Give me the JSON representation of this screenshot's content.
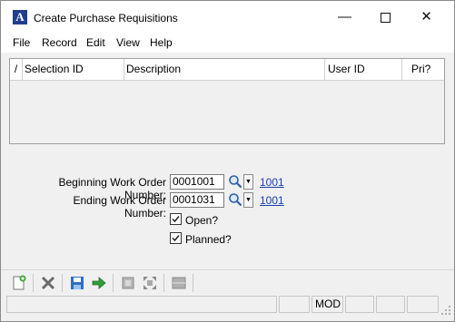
{
  "window": {
    "title": "Create Purchase Requisitions",
    "minimize": "—",
    "close": "✕"
  },
  "menu": [
    "File",
    "Record",
    "Edit",
    "View",
    "Help"
  ],
  "grid": {
    "sort_indicator": "/",
    "columns": [
      "Selection ID",
      "Description",
      "User ID",
      "Pri?"
    ],
    "rows": []
  },
  "form": {
    "begin_label": "Beginning Work Order Number:",
    "begin_value": "0001001",
    "begin_link": "1001",
    "end_label": "Ending Work Order Number:",
    "end_value": "0001031",
    "end_link": "1001",
    "open_label": "Open?",
    "open_checked": true,
    "planned_label": "Planned?",
    "planned_checked": true
  },
  "toolbar": {
    "icons": [
      "new-record-icon",
      "delete-icon",
      "save-icon",
      "proceed-icon",
      "detail-icon",
      "expand-icon",
      "list-icon"
    ]
  },
  "status": {
    "mode": "MOD"
  }
}
